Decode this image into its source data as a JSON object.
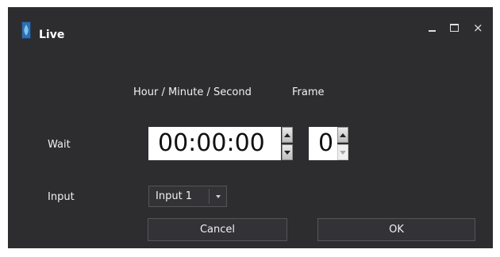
{
  "window": {
    "title": "Live",
    "controls": [
      "minimize-icon",
      "maximize-icon",
      "close-icon"
    ],
    "close_glyph": "×"
  },
  "headers": {
    "time": "Hour / Minute / Second",
    "frame": "Frame"
  },
  "wait": {
    "label": "Wait",
    "time_value": "00:00:00",
    "frame_value": "0"
  },
  "input": {
    "label": "Input",
    "selected": "Input 1"
  },
  "buttons": {
    "cancel": "Cancel",
    "ok": "OK"
  },
  "colors": {
    "background": "#2d2d30",
    "control": "#333337",
    "border": "#555558",
    "text": "#f1f1f1"
  }
}
